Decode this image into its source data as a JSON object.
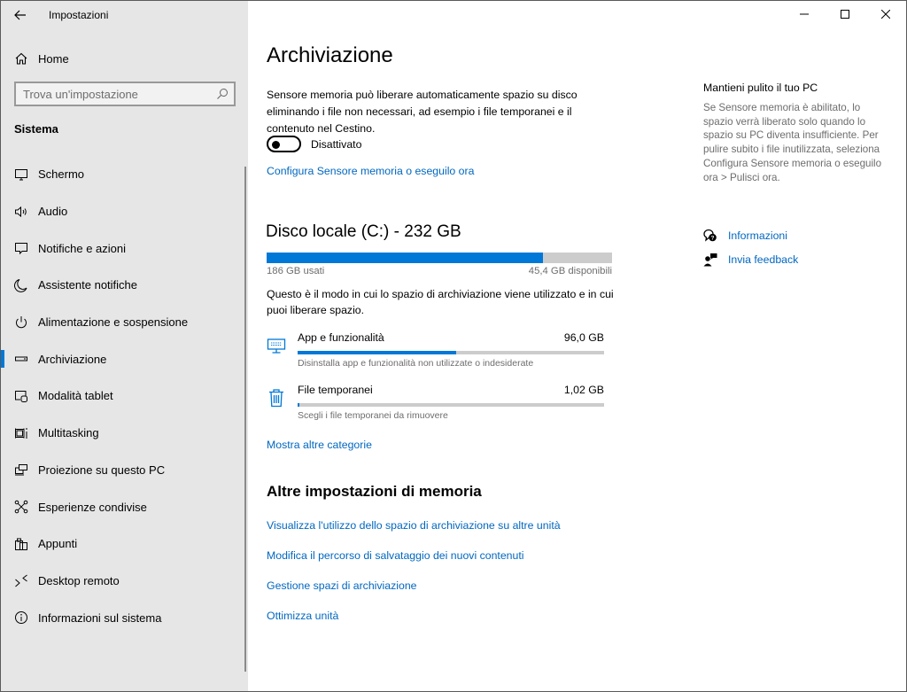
{
  "window": {
    "app_title": "Impostazioni",
    "controls": [
      "minimize",
      "maximize",
      "close"
    ]
  },
  "sidebar": {
    "home_label": "Home",
    "search_placeholder": "Trova un'impostazione",
    "section_label": "Sistema",
    "active_item": "Archiviazione",
    "items": [
      {
        "label": "Schermo",
        "icon": "monitor-icon"
      },
      {
        "label": "Audio",
        "icon": "speaker-icon"
      },
      {
        "label": "Notifiche e azioni",
        "icon": "message-icon"
      },
      {
        "label": "Assistente notifiche",
        "icon": "moon-icon"
      },
      {
        "label": "Alimentazione e sospensione",
        "icon": "power-icon"
      },
      {
        "label": "Archiviazione",
        "icon": "storage-drive-icon"
      },
      {
        "label": "Modalità tablet",
        "icon": "tablet-mode-icon"
      },
      {
        "label": "Multitasking",
        "icon": "multitasking-icon"
      },
      {
        "label": "Proiezione su questo PC",
        "icon": "projection-icon"
      },
      {
        "label": "Esperienze condivise",
        "icon": "shared-experiences-icon"
      },
      {
        "label": "Appunti",
        "icon": "clipboard-icon"
      },
      {
        "label": "Desktop remoto",
        "icon": "remote-desktop-icon"
      },
      {
        "label": "Informazioni sul sistema",
        "icon": "info-icon"
      }
    ]
  },
  "main": {
    "title": "Archiviazione",
    "storage_sense_desc": "Sensore memoria può liberare automaticamente spazio su disco eliminando i file non necessari, ad esempio i file temporanei e il contenuto nel Cestino.",
    "toggle": {
      "state": "off",
      "label": "Disattivato"
    },
    "configure_link": "Configura Sensore memoria o eseguilo ora",
    "disk": {
      "title": "Disco locale (C:) - 232 GB",
      "used_label": "186 GB usati",
      "free_label": "45,4 GB disponibili",
      "used_fraction": 0.8
    },
    "usage_desc": "Questo è il modo in cui lo spazio di archiviazione viene utilizzato e in cui puoi liberare spazio.",
    "categories": [
      {
        "name": "App e funzionalità",
        "size": "96,0 GB",
        "subtitle": "Disinstalla app e funzionalità non utilizzate o indesiderate",
        "fraction": 0.516,
        "icon": "apps-features-icon"
      },
      {
        "name": "File temporanei",
        "size": "1,02 GB",
        "subtitle": "Scegli i file temporanei da rimuovere",
        "fraction": 0.006,
        "icon": "trash-icon"
      }
    ],
    "more_link": "Mostra altre categorie",
    "other_title": "Altre impostazioni di memoria",
    "other_links": [
      "Visualizza l'utilizzo dello spazio di archiviazione su altre unità",
      "Modifica il percorso di salvataggio dei nuovi contenuti",
      "Gestione spazi di archiviazione",
      "Ottimizza unità"
    ]
  },
  "aside": {
    "title": "Mantieni pulito il tuo PC",
    "text": "Se Sensore memoria è abilitato, lo spazio verrà liberato solo quando lo spazio su PC diventa insufficiente. Per pulire subito i file inutilizzata, seleziona Configura Sensore memoria o eseguilo ora > Pulisci ora.",
    "links": [
      {
        "label": "Informazioni",
        "icon": "help-chat-icon"
      },
      {
        "label": "Invia feedback",
        "icon": "feedback-icon"
      }
    ]
  },
  "colors": {
    "accent": "#0078d7",
    "link": "#0067c0",
    "sidebar_bg": "#e6e6e6",
    "bar_track": "#cccccc",
    "secondary_text": "#6d6d6d"
  }
}
